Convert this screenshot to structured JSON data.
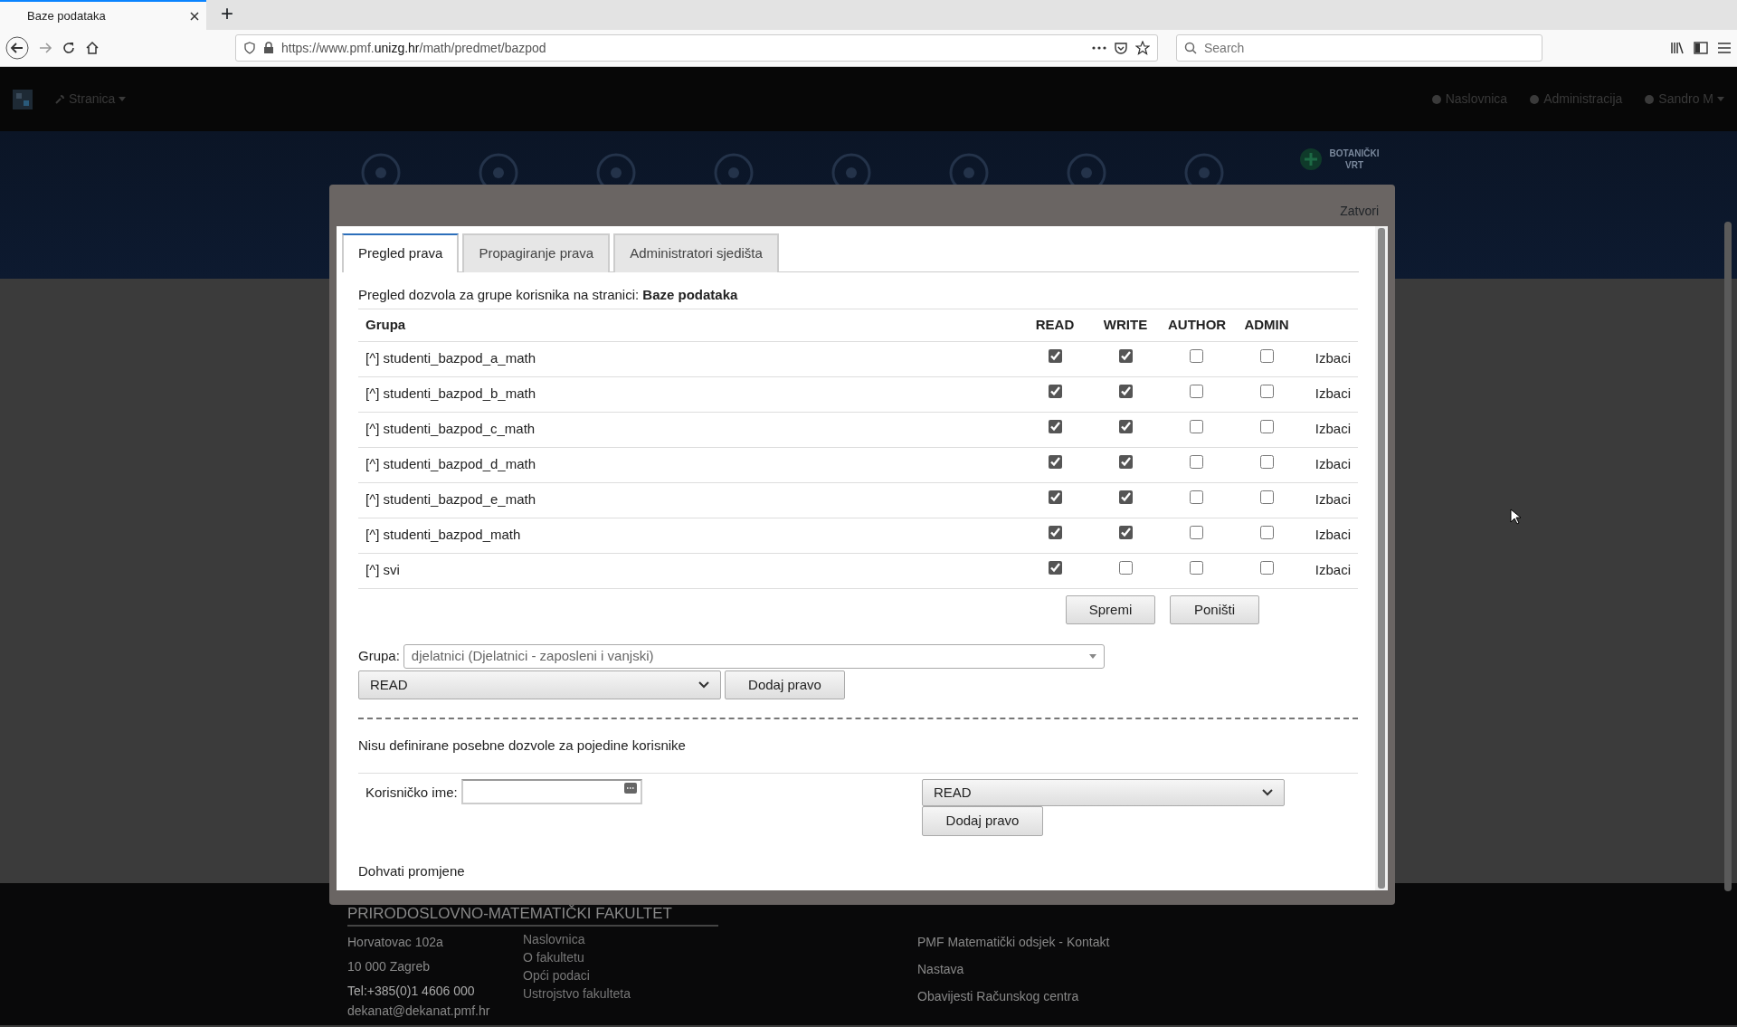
{
  "browser": {
    "tab_title": "Baze podataka",
    "new_tab": "+",
    "url_prefix": "https://www.pmf.",
    "url_host": "unizg.hr",
    "url_path": "/math/predmet/bazpod",
    "search_placeholder": "Search"
  },
  "navbar": {
    "menu": "Stranica",
    "right": [
      "Naslovnica",
      "Administracija",
      "Sandro M"
    ]
  },
  "banner": {
    "label_lines": [
      "BOTANIČKI",
      "VRT"
    ]
  },
  "modal": {
    "close": "Zatvori",
    "tabs": [
      {
        "label": "Pregled prava",
        "selected": true
      },
      {
        "label": "Propagiranje prava",
        "selected": false
      },
      {
        "label": "Administratori sjedišta",
        "selected": false
      }
    ],
    "intro": "Pregled dozvola za grupe korisnika na stranici: **Baze podataka**",
    "columns": [
      "Grupa",
      "READ",
      "WRITE",
      "AUTHOR",
      "ADMIN"
    ],
    "rows": [
      {
        "group": "[^] studenti_bazpod_a_math",
        "read": true,
        "write": true,
        "author": false,
        "admin": false,
        "action": "Izbaci"
      },
      {
        "group": "[^] studenti_bazpod_b_math",
        "read": true,
        "write": true,
        "author": false,
        "admin": false,
        "action": "Izbaci"
      },
      {
        "group": "[^] studenti_bazpod_c_math",
        "read": true,
        "write": true,
        "author": false,
        "admin": false,
        "action": "Izbaci"
      },
      {
        "group": "[^] studenti_bazpod_d_math",
        "read": true,
        "write": true,
        "author": false,
        "admin": false,
        "action": "Izbaci"
      },
      {
        "group": "[^] studenti_bazpod_e_math",
        "read": true,
        "write": true,
        "author": false,
        "admin": false,
        "action": "Izbaci"
      },
      {
        "group": "[^] studenti_bazpod_math",
        "read": true,
        "write": true,
        "author": false,
        "admin": false,
        "action": "Izbaci"
      },
      {
        "group": "[^] svi",
        "read": true,
        "write": false,
        "author": false,
        "admin": false,
        "action": "Izbaci"
      }
    ],
    "buttons": [
      "Spremi",
      "Poništi"
    ],
    "group_label": "Grupa:",
    "group_value": "djelatnici (Djelatnici - zaposleni i vanjski)",
    "group_right": "READ",
    "group_add": "Dodaj pravo",
    "user_note": "Nisu definirane posebne dozvole za pojedine korisnike",
    "user_label": "Korisničko ime:",
    "user_right": "READ",
    "user_add": "Dodaj pravo",
    "fetch_link": "Dohvati promjene"
  },
  "footer": {
    "title": "PRIRODOSLOVNO-MATEMATIČKI FAKULTET",
    "address": [
      "Horvatovac 102a",
      "10 000 Zagreb",
      "Tel:+385(0)1 4606 000",
      "dekanat@dekanat.pmf.hr"
    ],
    "links": [
      "Naslovnica",
      "O fakultetu",
      "Opći podaci",
      "Ustrojstvo fakulteta"
    ],
    "right_links": [
      "PMF Matematički odsjek - Kontakt",
      "Nastava",
      "Obavijesti Računskog centra"
    ]
  }
}
